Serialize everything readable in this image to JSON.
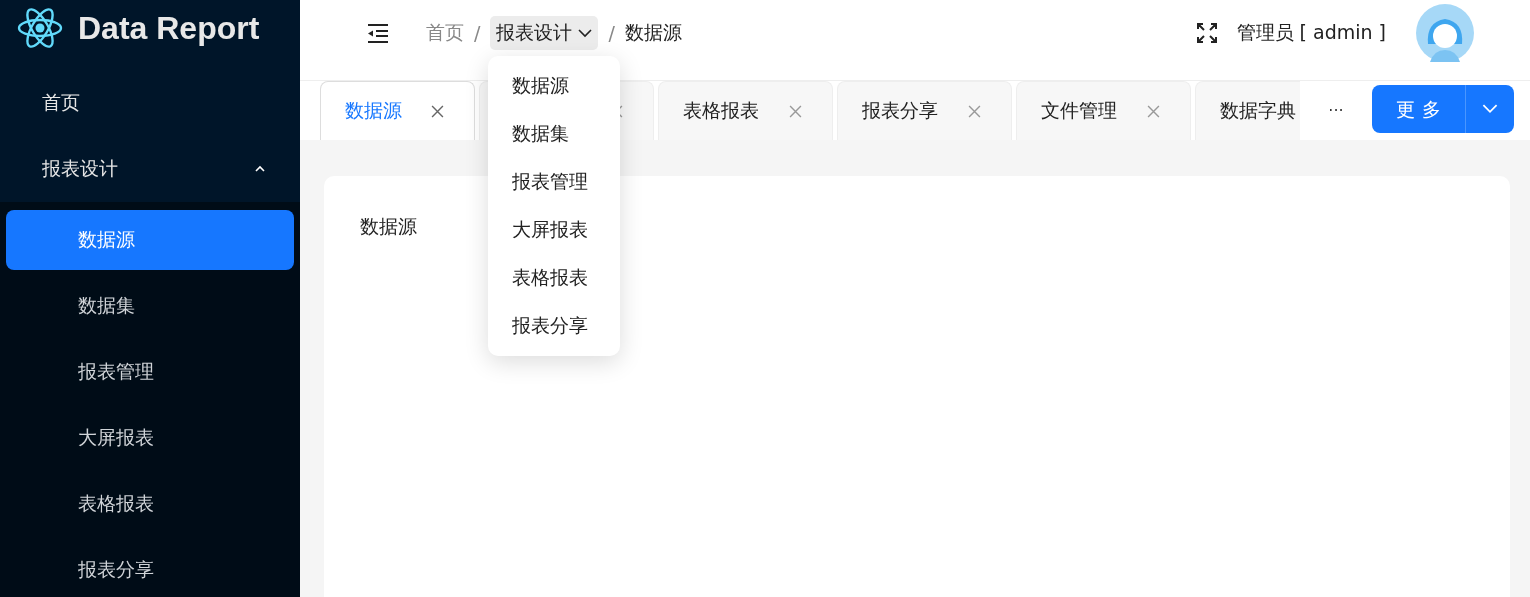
{
  "logo": {
    "title": "Data Report"
  },
  "sidebar": {
    "items": [
      {
        "label": "首页",
        "selected": false
      },
      {
        "label": "报表设计",
        "expanded": true,
        "children": [
          {
            "label": "数据源",
            "selected": true
          },
          {
            "label": "数据集",
            "selected": false
          },
          {
            "label": "报表管理",
            "selected": false
          },
          {
            "label": "大屏报表",
            "selected": false
          },
          {
            "label": "表格报表",
            "selected": false
          },
          {
            "label": "报表分享",
            "selected": false
          }
        ]
      }
    ]
  },
  "breadcrumb": [
    {
      "label": "首页",
      "kind": "link"
    },
    {
      "separator": "/",
      "label": "报表设计",
      "kind": "dropdown"
    },
    {
      "separator": "/",
      "label": "数据源",
      "kind": "current"
    }
  ],
  "breadcrumb_menu": {
    "items": [
      "数据源",
      "数据集",
      "报表管理",
      "大屏报表",
      "表格报表",
      "报表分享"
    ]
  },
  "user": {
    "name": "管理员 [ admin ]"
  },
  "tabs": [
    {
      "label": "数据源",
      "selected": true
    },
    {
      "selected": false
    },
    {
      "label": "表格报表",
      "selected": false
    },
    {
      "label": "报表分享",
      "selected": false
    },
    {
      "label": "文件管理",
      "selected": false
    },
    {
      "label": "数据字典",
      "selected": false
    }
  ],
  "tabs_overflow": "···",
  "more_button": {
    "label": "更 多"
  },
  "content": {
    "title": "数据源"
  }
}
